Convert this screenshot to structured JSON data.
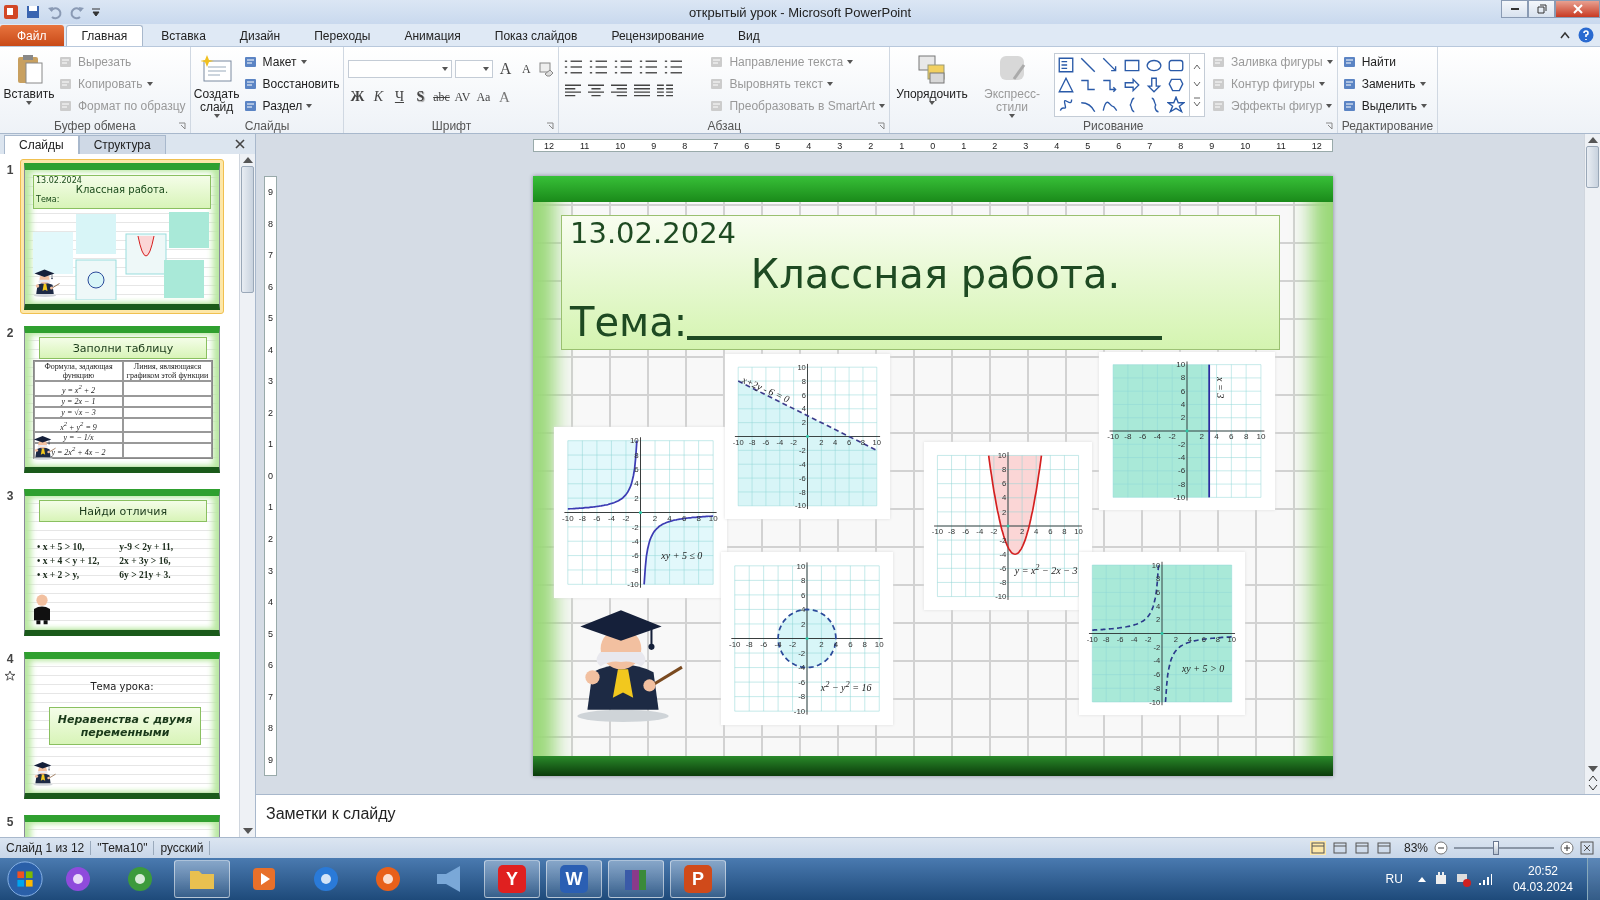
{
  "window": {
    "title": "открытый урок - Microsoft PowerPoint"
  },
  "ribbon_tabs": [
    {
      "label": "Файл",
      "kind": "file",
      "selected": false
    },
    {
      "label": "Главная",
      "kind": "tab",
      "selected": true
    },
    {
      "label": "Вставка",
      "kind": "tab",
      "selected": false
    },
    {
      "label": "Дизайн",
      "kind": "tab",
      "selected": false
    },
    {
      "label": "Переходы",
      "kind": "tab",
      "selected": false
    },
    {
      "label": "Анимация",
      "kind": "tab",
      "selected": false
    },
    {
      "label": "Показ слайдов",
      "kind": "tab",
      "selected": false
    },
    {
      "label": "Рецензирование",
      "kind": "tab",
      "selected": false
    },
    {
      "label": "Вид",
      "kind": "tab",
      "selected": false
    }
  ],
  "ribbon_groups": [
    {
      "kind": "clipboard",
      "label": "Буфер обмена",
      "big": [
        {
          "label": "Вставить",
          "disabled": false,
          "dropdown": true
        }
      ],
      "items": [
        {
          "label": "Вырезать",
          "disabled": true,
          "dropdown": false
        },
        {
          "label": "Копировать",
          "disabled": true,
          "dropdown": true
        },
        {
          "label": "Формат по образцу",
          "disabled": true,
          "dropdown": false
        }
      ]
    },
    {
      "kind": "slides",
      "label": "Слайды",
      "big": [
        {
          "label": "Создать слайд",
          "disabled": false,
          "dropdown": true
        }
      ],
      "items": [
        {
          "label": "Макет",
          "disabled": false,
          "dropdown": true
        },
        {
          "label": "Восстановить",
          "disabled": false,
          "dropdown": false
        },
        {
          "label": "Раздел",
          "disabled": false,
          "dropdown": true
        }
      ]
    },
    {
      "kind": "font",
      "label": "Шрифт",
      "buttons": [
        "A",
        "A",
        "Ж",
        "К",
        "Ч",
        "S",
        "abc",
        "AV",
        "Aa",
        "A"
      ]
    },
    {
      "kind": "paragraph",
      "label": "Абзац",
      "items": [
        {
          "label": "Направление текста",
          "disabled": true,
          "dropdown": true
        },
        {
          "label": "Выровнять текст",
          "disabled": true,
          "dropdown": true
        },
        {
          "label": "Преобразовать в SmartArt",
          "disabled": true,
          "dropdown": true
        }
      ]
    },
    {
      "kind": "drawing",
      "label": "Рисование",
      "big": [
        {
          "label": "Упорядочить",
          "disabled": false,
          "dropdown": true
        },
        {
          "label": "Экспресс-стили",
          "disabled": true,
          "dropdown": true
        }
      ],
      "items": [
        {
          "label": "Заливка фигуры",
          "disabled": true,
          "dropdown": true
        },
        {
          "label": "Контур фигуры",
          "disabled": true,
          "dropdown": true
        },
        {
          "label": "Эффекты фигур",
          "disabled": true,
          "dropdown": true
        }
      ]
    },
    {
      "kind": "editing",
      "label": "Редактирование",
      "items": [
        {
          "label": "Найти",
          "disabled": false,
          "dropdown": false
        },
        {
          "label": "Заменить",
          "disabled": false,
          "dropdown": true
        },
        {
          "label": "Выделить",
          "disabled": false,
          "dropdown": true
        }
      ]
    }
  ],
  "slides_pane": {
    "tabs": [
      {
        "label": "Слайды",
        "selected": true
      },
      {
        "label": "Структура",
        "selected": false
      }
    ],
    "slides": [
      {
        "number": "1",
        "selected": true,
        "animated": false,
        "kind": "title-graphs",
        "date": "13.02.2024",
        "title": "Классная работа.",
        "subtitle": "Тема:"
      },
      {
        "number": "2",
        "selected": false,
        "animated": false,
        "kind": "table",
        "title": "Заполни таблицу",
        "columns": [
          "Формула, задающая функцию",
          "Линия, являющаяся графиком этой функции"
        ],
        "rows": [
          "y = x$^{2}$ + 2",
          "y = 2x − 1",
          "y = √x − 3",
          "x$^{2}$ + y$^{2}$ = 9",
          "y = − 1/x",
          "y = 2x$^{2}$ + 4x − 2"
        ]
      },
      {
        "number": "3",
        "selected": false,
        "animated": false,
        "kind": "list",
        "title": "Найди отличия",
        "left": [
          "• x + 5 > 10,",
          "• x + 4 < y + 12,",
          "• x + 2 > y,"
        ],
        "right": [
          "y-9 < 2y + 11,",
          "2x + 3y > 16,",
          "6y > 21y + 3."
        ]
      },
      {
        "number": "4",
        "selected": false,
        "animated": true,
        "kind": "topic",
        "title": "Тема урока:",
        "subtitle": "Неравенства с двумя переменными"
      },
      {
        "number": "5",
        "selected": false,
        "animated": false,
        "kind": "partial"
      }
    ]
  },
  "ruler": {
    "horizontal": [
      "12",
      "11",
      "10",
      "9",
      "8",
      "7",
      "6",
      "5",
      "4",
      "3",
      "2",
      "1",
      "0",
      "1",
      "2",
      "3",
      "4",
      "5",
      "6",
      "7",
      "8",
      "9",
      "10",
      "11",
      "12"
    ],
    "vertical": [
      "9",
      "8",
      "7",
      "6",
      "5",
      "4",
      "3",
      "2",
      "1",
      "0",
      "1",
      "2",
      "3",
      "4",
      "5",
      "6",
      "7",
      "8",
      "9"
    ]
  },
  "slide": {
    "date": "13.02.2024",
    "title": "Классная работа.",
    "subject": "Тема:",
    "graphs": [
      {
        "kind": "hyperbola-le",
        "label": "xy + 5 ≤ 0",
        "x_ticks": [
          "-10",
          "-8",
          "-6",
          "-4",
          "-2",
          "2",
          "4",
          "6",
          "8",
          "10"
        ],
        "y_ticks": [
          "10",
          "8",
          "6",
          "4",
          "2",
          "-2",
          "-4",
          "-6",
          "-8",
          "-10"
        ]
      },
      {
        "kind": "line",
        "label": "x+2y - 6 = 0",
        "x_ticks": [
          "-10",
          "-8",
          "-6",
          "-4",
          "-2",
          "2",
          "4",
          "6",
          "8",
          "10"
        ],
        "y_ticks": [
          "10",
          "8",
          "6",
          "4",
          "2",
          "-2",
          "-4",
          "-6",
          "-8",
          "-10"
        ]
      },
      {
        "kind": "parabola",
        "label": "y = x$^{2}$ − 2x − 3",
        "x_ticks": [
          "-10",
          "-8",
          "-6",
          "-4",
          "-2",
          "2",
          "4",
          "6",
          "8",
          "10"
        ],
        "y_ticks": [
          "10",
          "8",
          "6",
          "4",
          "2",
          "-2",
          "-4",
          "-6",
          "-8",
          "-10"
        ]
      },
      {
        "kind": "vertical",
        "label": "x = 3",
        "x_ticks": [
          "-10",
          "-8",
          "-6",
          "-4",
          "-2",
          "2",
          "4",
          "6",
          "8",
          "10"
        ],
        "y_ticks": [
          "10",
          "8",
          "6",
          "4",
          "2",
          "-2",
          "-4",
          "-6",
          "-8",
          "-10"
        ]
      },
      {
        "kind": "circle",
        "label": "x$^{2}$ − y$^{2}$ = 16",
        "x_ticks": [
          "-10",
          "-8",
          "-6",
          "-4",
          "-2",
          "2",
          "4",
          "6",
          "8",
          "10"
        ],
        "y_ticks": [
          "10",
          "8",
          "6",
          "4",
          "2",
          "-2",
          "-4",
          "-6",
          "-8",
          "-10"
        ]
      },
      {
        "kind": "hyperbola-gt",
        "label": "xy + 5 > 0",
        "x_ticks": [
          "-10",
          "-8",
          "-6",
          "-4",
          "-2",
          "2",
          "4",
          "6",
          "8",
          "10"
        ],
        "y_ticks": [
          "10",
          "8",
          "6",
          "4",
          "2",
          "-2",
          "-4",
          "-6",
          "-8",
          "-10"
        ]
      }
    ]
  },
  "notes": {
    "placeholder": "Заметки к слайду"
  },
  "status_bar": {
    "slide": "Слайд 1 из 12",
    "theme": "\"Тема10\"",
    "language": "русский",
    "zoom": "83%",
    "zoom_slider": {
      "level": 0.42
    }
  },
  "taskbar": {
    "apps": [
      {
        "kind": "assistant",
        "running": false
      },
      {
        "kind": "chrome",
        "running": false
      },
      {
        "kind": "folder",
        "running": true
      },
      {
        "kind": "media",
        "running": false
      },
      {
        "kind": "ie",
        "running": false
      },
      {
        "kind": "firefox",
        "running": false
      },
      {
        "kind": "speaker",
        "running": false
      },
      {
        "kind": "yandex",
        "running": true,
        "glyph": "Y"
      },
      {
        "kind": "word",
        "running": true,
        "glyph": "W"
      },
      {
        "kind": "archive",
        "running": true
      },
      {
        "kind": "powerpoint",
        "running": true,
        "glyph": "P"
      }
    ],
    "language": "RU",
    "time": "20:52",
    "date": "04.03.2024"
  }
}
